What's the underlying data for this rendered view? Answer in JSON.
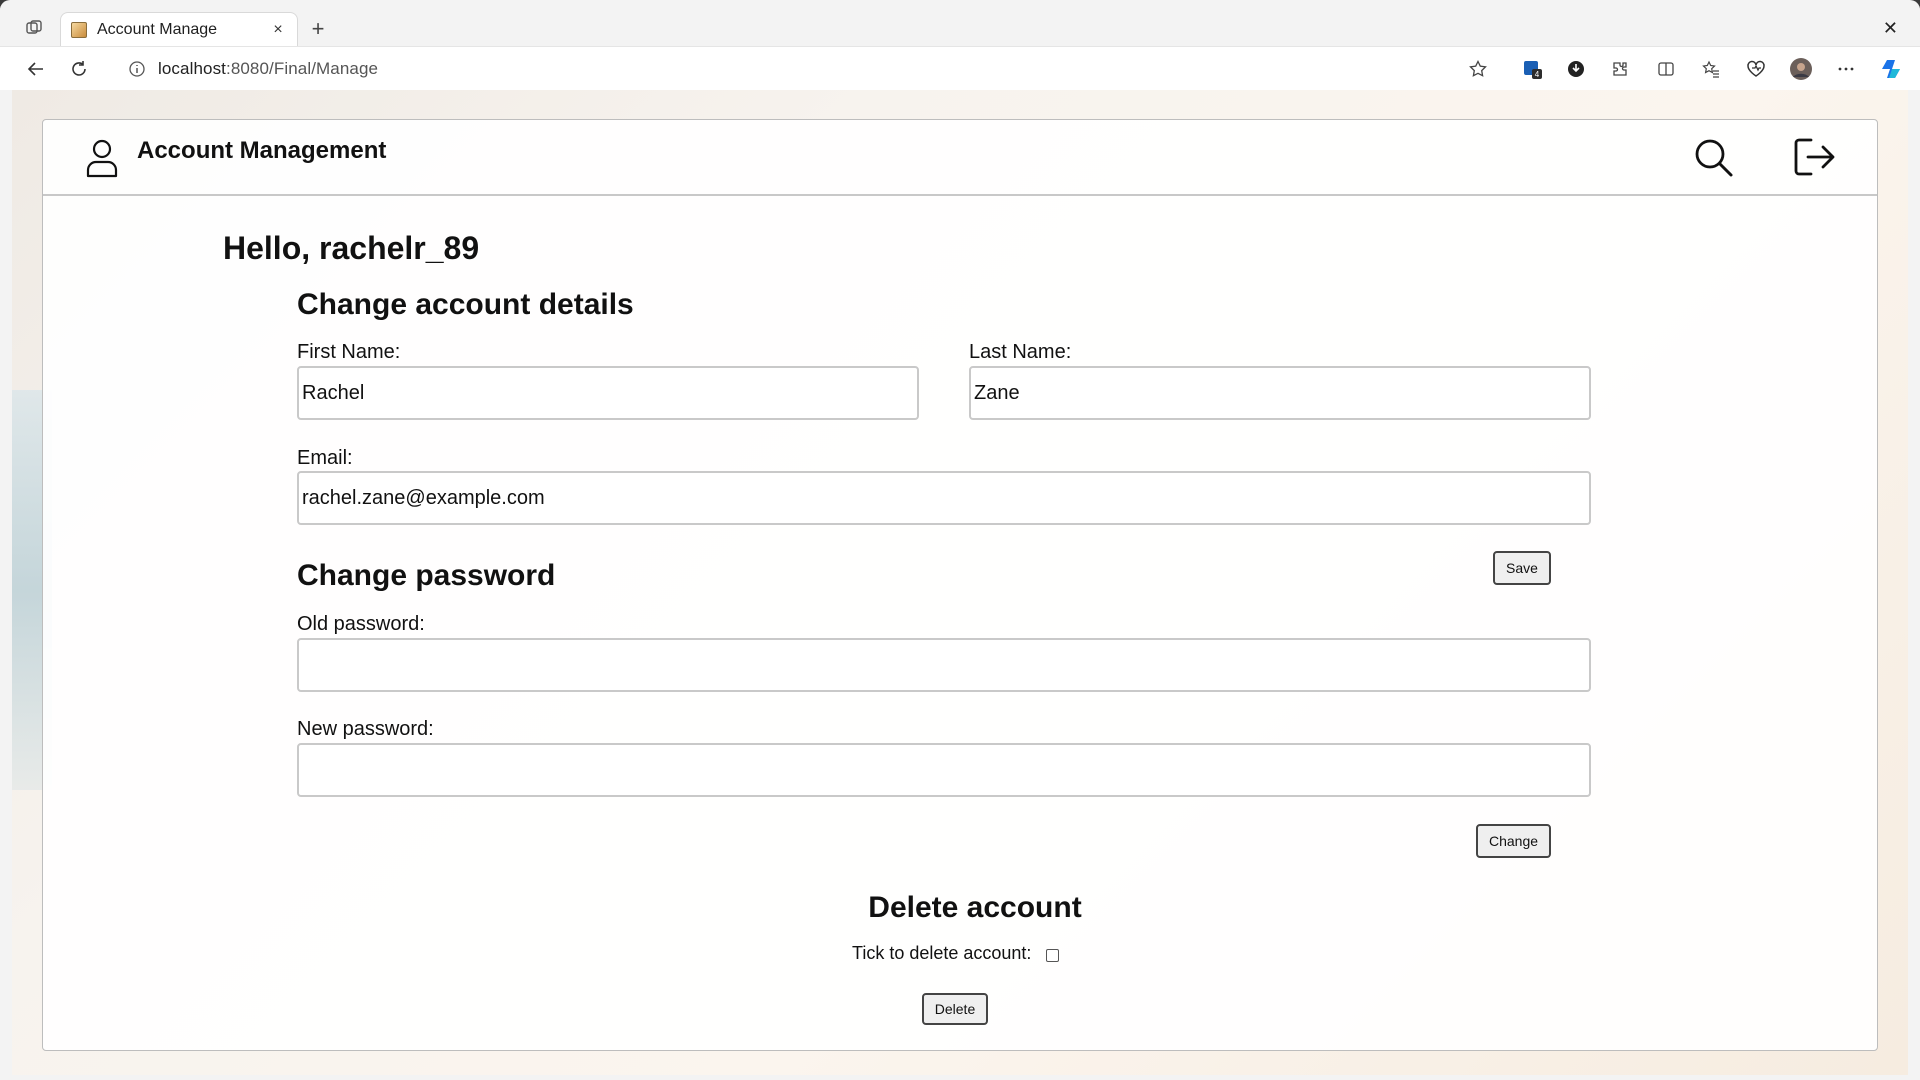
{
  "browser": {
    "tab_title": "Account Manage",
    "tab_close": "×",
    "new_tab": "+",
    "window_close": "✕",
    "url_host": "localhost",
    "url_path": ":8080/Final/Manage"
  },
  "header": {
    "title": "Account Management"
  },
  "greeting": "Hello, rachelr_89",
  "account_details": {
    "title": "Change account details",
    "first_name_label": "First Name:",
    "first_name_value": "Rachel",
    "last_name_label": "Last Name:",
    "last_name_value": "Zane",
    "email_label": "Email:",
    "email_value": "rachel.zane@example.com",
    "save_label": "Save"
  },
  "password": {
    "title": "Change password",
    "old_label": "Old password:",
    "old_value": "",
    "new_label": "New password:",
    "new_value": "",
    "change_label": "Change"
  },
  "delete": {
    "title": "Delete account",
    "tick_label": "Tick to delete account:",
    "checked": false,
    "delete_label": "Delete"
  },
  "colors": {
    "accent_copilot": "#1a73e8",
    "border": "#c9c9c9"
  }
}
